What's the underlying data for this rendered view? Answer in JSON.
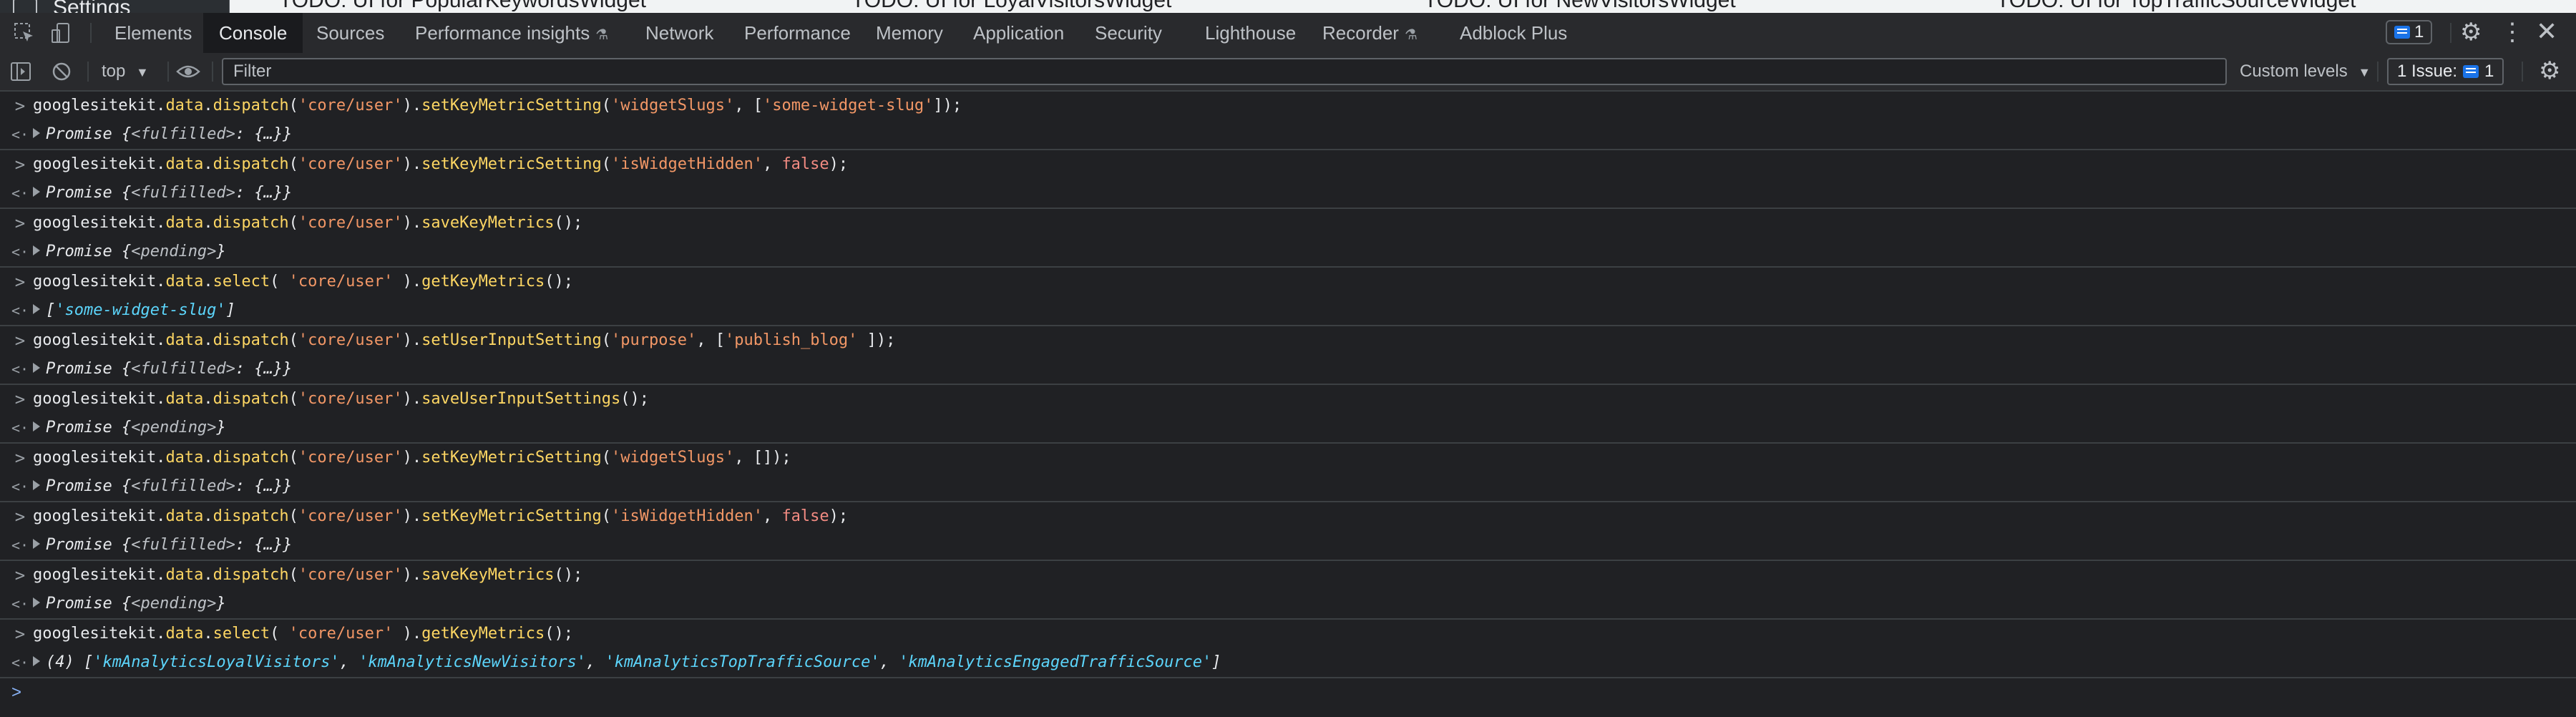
{
  "webpage_strip": {
    "settings_label": "Settings",
    "todo_items": [
      "TODO: UI for PopularKeywordsWidget",
      "TODO: UI for LoyalVisitorsWidget",
      "TODO: UI for NewVisitorsWidget",
      "TODO: UI for TopTrafficSourceWidget"
    ]
  },
  "tabs": [
    {
      "label": "Elements",
      "active": false
    },
    {
      "label": "Console",
      "active": true
    },
    {
      "label": "Sources",
      "active": false
    },
    {
      "label": "Performance insights",
      "active": false,
      "experimental": true
    },
    {
      "label": "Network",
      "active": false
    },
    {
      "label": "Performance",
      "active": false
    },
    {
      "label": "Memory",
      "active": false
    },
    {
      "label": "Application",
      "active": false
    },
    {
      "label": "Security",
      "active": false
    },
    {
      "label": "Lighthouse",
      "active": false
    },
    {
      "label": "Recorder",
      "active": false,
      "experimental": true
    },
    {
      "label": "Adblock Plus",
      "active": false
    }
  ],
  "tabbar_right": {
    "messages_count": "1"
  },
  "console_toolbar": {
    "context": "top",
    "filter_placeholder": "Filter",
    "levels": "Custom levels",
    "issues_label": "1 Issue:",
    "issues_count": "1"
  },
  "entries": [
    {
      "input": [
        [
          "googlesitekit.",
          "ident"
        ],
        [
          "data",
          "prop"
        ],
        [
          ".",
          "punc"
        ],
        [
          "dispatch",
          "prop"
        ],
        [
          "(",
          "punc"
        ],
        [
          "'core/user'",
          "str"
        ],
        [
          ").",
          "punc"
        ],
        [
          "setKeyMetricSetting",
          "prop"
        ],
        [
          "(",
          "punc"
        ],
        [
          "'widgetSlugs'",
          "str"
        ],
        [
          ", [",
          "punc"
        ],
        [
          "'some-widget-slug'",
          "str"
        ],
        [
          "]);",
          "punc"
        ]
      ],
      "output": [
        [
          "Promise {",
          "ob"
        ],
        [
          "<fulfilled>",
          "state"
        ],
        [
          ": {…}}",
          "ob"
        ]
      ]
    },
    {
      "input": [
        [
          "googlesitekit.",
          "ident"
        ],
        [
          "data",
          "prop"
        ],
        [
          ".",
          "punc"
        ],
        [
          "dispatch",
          "prop"
        ],
        [
          "(",
          "punc"
        ],
        [
          "'core/user'",
          "str"
        ],
        [
          ").",
          "punc"
        ],
        [
          "setKeyMetricSetting",
          "prop"
        ],
        [
          "(",
          "punc"
        ],
        [
          "'isWidgetHidden'",
          "str"
        ],
        [
          ", ",
          "punc"
        ],
        [
          "false",
          "bool"
        ],
        [
          ");",
          "punc"
        ]
      ],
      "output": [
        [
          "Promise {",
          "ob"
        ],
        [
          "<fulfilled>",
          "state"
        ],
        [
          ": {…}}",
          "ob"
        ]
      ]
    },
    {
      "input": [
        [
          "googlesitekit.",
          "ident"
        ],
        [
          "data",
          "prop"
        ],
        [
          ".",
          "punc"
        ],
        [
          "dispatch",
          "prop"
        ],
        [
          "(",
          "punc"
        ],
        [
          "'core/user'",
          "str"
        ],
        [
          ").",
          "punc"
        ],
        [
          "saveKeyMetrics",
          "prop"
        ],
        [
          "();",
          "punc"
        ]
      ],
      "output": [
        [
          "Promise {",
          "ob"
        ],
        [
          "<pending>",
          "state"
        ],
        [
          "}",
          "ob"
        ]
      ]
    },
    {
      "input": [
        [
          "googlesitekit.",
          "ident"
        ],
        [
          "data",
          "prop"
        ],
        [
          ".",
          "punc"
        ],
        [
          "select",
          "prop"
        ],
        [
          "( ",
          "punc"
        ],
        [
          "'core/user'",
          "str"
        ],
        [
          " ).",
          "punc"
        ],
        [
          "getKeyMetrics",
          "prop"
        ],
        [
          "();",
          "punc"
        ]
      ],
      "output": [
        [
          "[",
          "ob"
        ],
        [
          "'some-widget-slug'",
          "teal"
        ],
        [
          "]",
          "ob"
        ]
      ]
    },
    {
      "input": [
        [
          "googlesitekit.",
          "ident"
        ],
        [
          "data",
          "prop"
        ],
        [
          ".",
          "punc"
        ],
        [
          "dispatch",
          "prop"
        ],
        [
          "(",
          "punc"
        ],
        [
          "'core/user'",
          "str"
        ],
        [
          ").",
          "punc"
        ],
        [
          "setUserInputSetting",
          "prop"
        ],
        [
          "(",
          "punc"
        ],
        [
          "'purpose'",
          "str"
        ],
        [
          ", [",
          "punc"
        ],
        [
          "'publish_blog'",
          "str"
        ],
        [
          " ]);",
          "punc"
        ]
      ],
      "output": [
        [
          "Promise {",
          "ob"
        ],
        [
          "<fulfilled>",
          "state"
        ],
        [
          ": {…}}",
          "ob"
        ]
      ]
    },
    {
      "input": [
        [
          "googlesitekit.",
          "ident"
        ],
        [
          "data",
          "prop"
        ],
        [
          ".",
          "punc"
        ],
        [
          "dispatch",
          "prop"
        ],
        [
          "(",
          "punc"
        ],
        [
          "'core/user'",
          "str"
        ],
        [
          ").",
          "punc"
        ],
        [
          "saveUserInputSettings",
          "prop"
        ],
        [
          "();",
          "punc"
        ]
      ],
      "output": [
        [
          "Promise {",
          "ob"
        ],
        [
          "<pending>",
          "state"
        ],
        [
          "}",
          "ob"
        ]
      ]
    },
    {
      "input": [
        [
          "googlesitekit.",
          "ident"
        ],
        [
          "data",
          "prop"
        ],
        [
          ".",
          "punc"
        ],
        [
          "dispatch",
          "prop"
        ],
        [
          "(",
          "punc"
        ],
        [
          "'core/user'",
          "str"
        ],
        [
          ").",
          "punc"
        ],
        [
          "setKeyMetricSetting",
          "prop"
        ],
        [
          "(",
          "punc"
        ],
        [
          "'widgetSlugs'",
          "str"
        ],
        [
          ", []);",
          "punc"
        ]
      ],
      "output": [
        [
          "Promise {",
          "ob"
        ],
        [
          "<fulfilled>",
          "state"
        ],
        [
          ": {…}}",
          "ob"
        ]
      ]
    },
    {
      "input": [
        [
          "googlesitekit.",
          "ident"
        ],
        [
          "data",
          "prop"
        ],
        [
          ".",
          "punc"
        ],
        [
          "dispatch",
          "prop"
        ],
        [
          "(",
          "punc"
        ],
        [
          "'core/user'",
          "str"
        ],
        [
          ").",
          "punc"
        ],
        [
          "setKeyMetricSetting",
          "prop"
        ],
        [
          "(",
          "punc"
        ],
        [
          "'isWidgetHidden'",
          "str"
        ],
        [
          ", ",
          "punc"
        ],
        [
          "false",
          "bool"
        ],
        [
          ");",
          "punc"
        ]
      ],
      "output": [
        [
          "Promise {",
          "ob"
        ],
        [
          "<fulfilled>",
          "state"
        ],
        [
          ": {…}}",
          "ob"
        ]
      ]
    },
    {
      "input": [
        [
          "googlesitekit.",
          "ident"
        ],
        [
          "data",
          "prop"
        ],
        [
          ".",
          "punc"
        ],
        [
          "dispatch",
          "prop"
        ],
        [
          "(",
          "punc"
        ],
        [
          "'core/user'",
          "str"
        ],
        [
          ").",
          "punc"
        ],
        [
          "saveKeyMetrics",
          "prop"
        ],
        [
          "();",
          "punc"
        ]
      ],
      "output": [
        [
          "Promise {",
          "ob"
        ],
        [
          "<pending>",
          "state"
        ],
        [
          "}",
          "ob"
        ]
      ]
    },
    {
      "input": [
        [
          "googlesitekit.",
          "ident"
        ],
        [
          "data",
          "prop"
        ],
        [
          ".",
          "punc"
        ],
        [
          "select",
          "prop"
        ],
        [
          "( ",
          "punc"
        ],
        [
          "'core/user'",
          "str"
        ],
        [
          " ).",
          "punc"
        ],
        [
          "getKeyMetrics",
          "prop"
        ],
        [
          "();",
          "punc"
        ]
      ],
      "output": [
        [
          "(4) [",
          "ob"
        ],
        [
          "'kmAnalyticsLoyalVisitors'",
          "teal"
        ],
        [
          ", ",
          "ob"
        ],
        [
          "'kmAnalyticsNewVisitors'",
          "teal"
        ],
        [
          ", ",
          "ob"
        ],
        [
          "'kmAnalyticsTopTrafficSource'",
          "teal"
        ],
        [
          ", ",
          "ob"
        ],
        [
          "'kmAnalyticsEngagedTrafficSource'",
          "teal"
        ],
        [
          "]",
          "ob"
        ]
      ]
    }
  ],
  "glyphs": {
    "input_gutter": ">",
    "output_gutter": "<·",
    "prompt": ">"
  },
  "colors": {
    "background": "#202124",
    "string": "#f29766",
    "property": "#fdd663",
    "boolean": "#f28b82",
    "array_item": "#5cd5fb",
    "accent": "#8ab4f8"
  }
}
